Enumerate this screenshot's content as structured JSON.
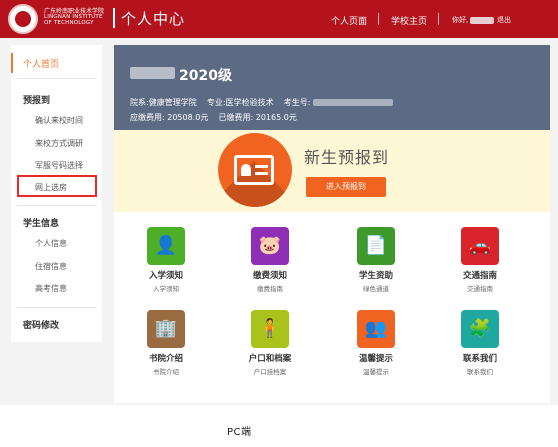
{
  "header": {
    "school_cn": "广东岭南职业技术学院",
    "school_en": "LINGNAN INSTITUTE OF TECHNOLOGY",
    "title": "个人中心",
    "nav": [
      "个人页面",
      "学校主页"
    ],
    "greeting": "你好,",
    "logout": "退出"
  },
  "sidebar": {
    "active": "个人首页",
    "sections": [
      {
        "title": "预报到",
        "items": [
          "确认来校时间",
          "来校方式调研",
          "军服号码选择",
          "网上选房"
        ]
      },
      {
        "title": "学生信息",
        "items": [
          "个人信息",
          "住宿信息",
          "高考信息"
        ]
      },
      {
        "title": "密码修改",
        "items": []
      }
    ]
  },
  "profile": {
    "year": "2020级",
    "dept_label": "院系:",
    "dept": "健康管理学院",
    "major_label": "专业:",
    "major": "医学检验技术",
    "exam_label": "考生号:",
    "fee_due": "应缴费用: 20508.0元",
    "fee_paid": "已缴费用: 20165.0元"
  },
  "promo": {
    "title": "新生预报到",
    "button": "进入预报到"
  },
  "tiles": [
    {
      "title": "入学须知",
      "sub": "入学须知",
      "color": "#4caf27",
      "icon": "person-icon",
      "glyph": "👤"
    },
    {
      "title": "缴费须知",
      "sub": "缴费指南",
      "color": "#8e2fb5",
      "icon": "piggy-bank-icon",
      "glyph": "🐷"
    },
    {
      "title": "学生资助",
      "sub": "绿色通道",
      "color": "#3e9a2a",
      "icon": "document-icon",
      "glyph": "📄"
    },
    {
      "title": "交通指南",
      "sub": "交通指南",
      "color": "#d9242c",
      "icon": "car-icon",
      "glyph": "🚗"
    },
    {
      "title": "书院介绍",
      "sub": "书院介绍",
      "color": "#9a6b40",
      "icon": "building-icon",
      "glyph": "🏢"
    },
    {
      "title": "户口和档案",
      "sub": "户口挂档案",
      "color": "#a9c21c",
      "icon": "person-standing-icon",
      "glyph": "🧍"
    },
    {
      "title": "温馨提示",
      "sub": "温馨提示",
      "color": "#f06320",
      "icon": "group-icon",
      "glyph": "👥"
    },
    {
      "title": "联系我们",
      "sub": "联系我们",
      "color": "#1fa8a0",
      "icon": "puzzle-icon",
      "glyph": "🧩"
    }
  ],
  "caption": "PC端"
}
